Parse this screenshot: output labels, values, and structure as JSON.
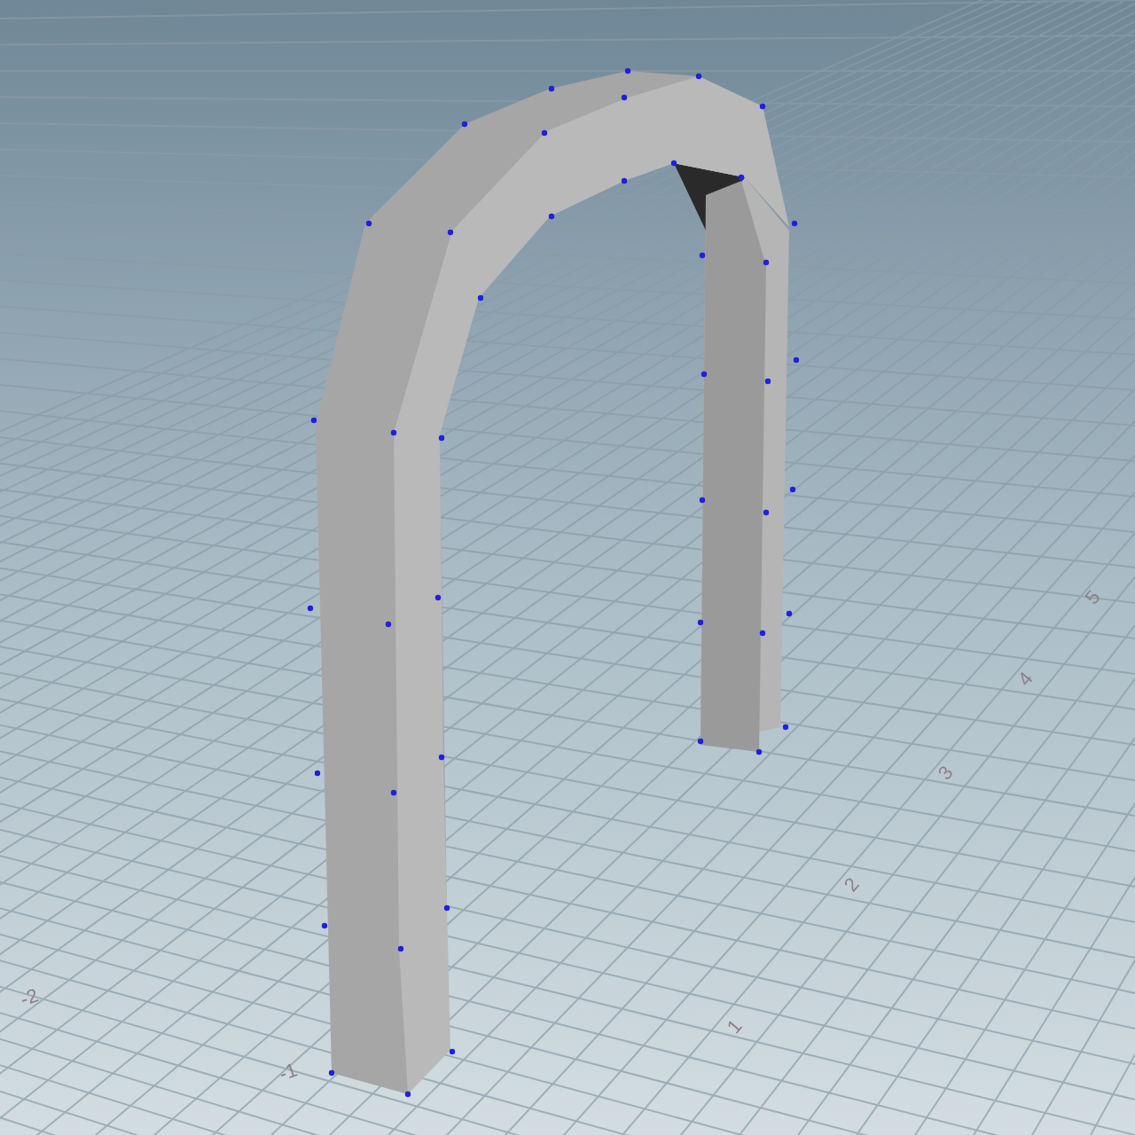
{
  "viewport": {
    "grid_labels": [
      "-2",
      "-1",
      "1",
      "2",
      "3",
      "4",
      "5"
    ]
  }
}
